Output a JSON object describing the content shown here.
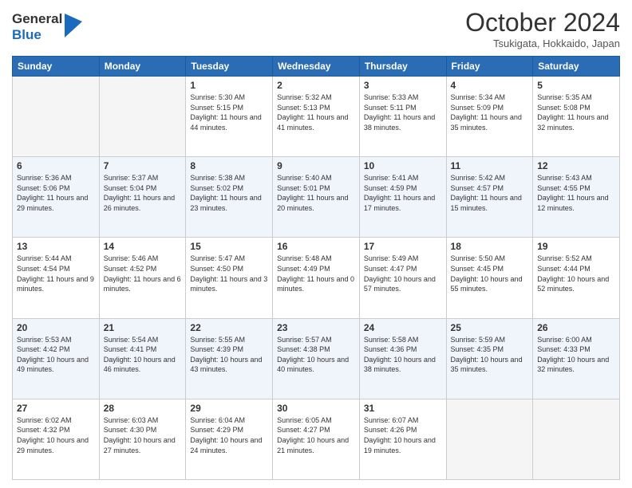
{
  "header": {
    "logo_general": "General",
    "logo_blue": "Blue",
    "month": "October 2024",
    "location": "Tsukigata, Hokkaido, Japan"
  },
  "weekdays": [
    "Sunday",
    "Monday",
    "Tuesday",
    "Wednesday",
    "Thursday",
    "Friday",
    "Saturday"
  ],
  "weeks": [
    [
      {
        "day": "",
        "info": ""
      },
      {
        "day": "",
        "info": ""
      },
      {
        "day": "1",
        "info": "Sunrise: 5:30 AM\nSunset: 5:15 PM\nDaylight: 11 hours and 44 minutes."
      },
      {
        "day": "2",
        "info": "Sunrise: 5:32 AM\nSunset: 5:13 PM\nDaylight: 11 hours and 41 minutes."
      },
      {
        "day": "3",
        "info": "Sunrise: 5:33 AM\nSunset: 5:11 PM\nDaylight: 11 hours and 38 minutes."
      },
      {
        "day": "4",
        "info": "Sunrise: 5:34 AM\nSunset: 5:09 PM\nDaylight: 11 hours and 35 minutes."
      },
      {
        "day": "5",
        "info": "Sunrise: 5:35 AM\nSunset: 5:08 PM\nDaylight: 11 hours and 32 minutes."
      }
    ],
    [
      {
        "day": "6",
        "info": "Sunrise: 5:36 AM\nSunset: 5:06 PM\nDaylight: 11 hours and 29 minutes."
      },
      {
        "day": "7",
        "info": "Sunrise: 5:37 AM\nSunset: 5:04 PM\nDaylight: 11 hours and 26 minutes."
      },
      {
        "day": "8",
        "info": "Sunrise: 5:38 AM\nSunset: 5:02 PM\nDaylight: 11 hours and 23 minutes."
      },
      {
        "day": "9",
        "info": "Sunrise: 5:40 AM\nSunset: 5:01 PM\nDaylight: 11 hours and 20 minutes."
      },
      {
        "day": "10",
        "info": "Sunrise: 5:41 AM\nSunset: 4:59 PM\nDaylight: 11 hours and 17 minutes."
      },
      {
        "day": "11",
        "info": "Sunrise: 5:42 AM\nSunset: 4:57 PM\nDaylight: 11 hours and 15 minutes."
      },
      {
        "day": "12",
        "info": "Sunrise: 5:43 AM\nSunset: 4:55 PM\nDaylight: 11 hours and 12 minutes."
      }
    ],
    [
      {
        "day": "13",
        "info": "Sunrise: 5:44 AM\nSunset: 4:54 PM\nDaylight: 11 hours and 9 minutes."
      },
      {
        "day": "14",
        "info": "Sunrise: 5:46 AM\nSunset: 4:52 PM\nDaylight: 11 hours and 6 minutes."
      },
      {
        "day": "15",
        "info": "Sunrise: 5:47 AM\nSunset: 4:50 PM\nDaylight: 11 hours and 3 minutes."
      },
      {
        "day": "16",
        "info": "Sunrise: 5:48 AM\nSunset: 4:49 PM\nDaylight: 11 hours and 0 minutes."
      },
      {
        "day": "17",
        "info": "Sunrise: 5:49 AM\nSunset: 4:47 PM\nDaylight: 10 hours and 57 minutes."
      },
      {
        "day": "18",
        "info": "Sunrise: 5:50 AM\nSunset: 4:45 PM\nDaylight: 10 hours and 55 minutes."
      },
      {
        "day": "19",
        "info": "Sunrise: 5:52 AM\nSunset: 4:44 PM\nDaylight: 10 hours and 52 minutes."
      }
    ],
    [
      {
        "day": "20",
        "info": "Sunrise: 5:53 AM\nSunset: 4:42 PM\nDaylight: 10 hours and 49 minutes."
      },
      {
        "day": "21",
        "info": "Sunrise: 5:54 AM\nSunset: 4:41 PM\nDaylight: 10 hours and 46 minutes."
      },
      {
        "day": "22",
        "info": "Sunrise: 5:55 AM\nSunset: 4:39 PM\nDaylight: 10 hours and 43 minutes."
      },
      {
        "day": "23",
        "info": "Sunrise: 5:57 AM\nSunset: 4:38 PM\nDaylight: 10 hours and 40 minutes."
      },
      {
        "day": "24",
        "info": "Sunrise: 5:58 AM\nSunset: 4:36 PM\nDaylight: 10 hours and 38 minutes."
      },
      {
        "day": "25",
        "info": "Sunrise: 5:59 AM\nSunset: 4:35 PM\nDaylight: 10 hours and 35 minutes."
      },
      {
        "day": "26",
        "info": "Sunrise: 6:00 AM\nSunset: 4:33 PM\nDaylight: 10 hours and 32 minutes."
      }
    ],
    [
      {
        "day": "27",
        "info": "Sunrise: 6:02 AM\nSunset: 4:32 PM\nDaylight: 10 hours and 29 minutes."
      },
      {
        "day": "28",
        "info": "Sunrise: 6:03 AM\nSunset: 4:30 PM\nDaylight: 10 hours and 27 minutes."
      },
      {
        "day": "29",
        "info": "Sunrise: 6:04 AM\nSunset: 4:29 PM\nDaylight: 10 hours and 24 minutes."
      },
      {
        "day": "30",
        "info": "Sunrise: 6:05 AM\nSunset: 4:27 PM\nDaylight: 10 hours and 21 minutes."
      },
      {
        "day": "31",
        "info": "Sunrise: 6:07 AM\nSunset: 4:26 PM\nDaylight: 10 hours and 19 minutes."
      },
      {
        "day": "",
        "info": ""
      },
      {
        "day": "",
        "info": ""
      }
    ]
  ]
}
